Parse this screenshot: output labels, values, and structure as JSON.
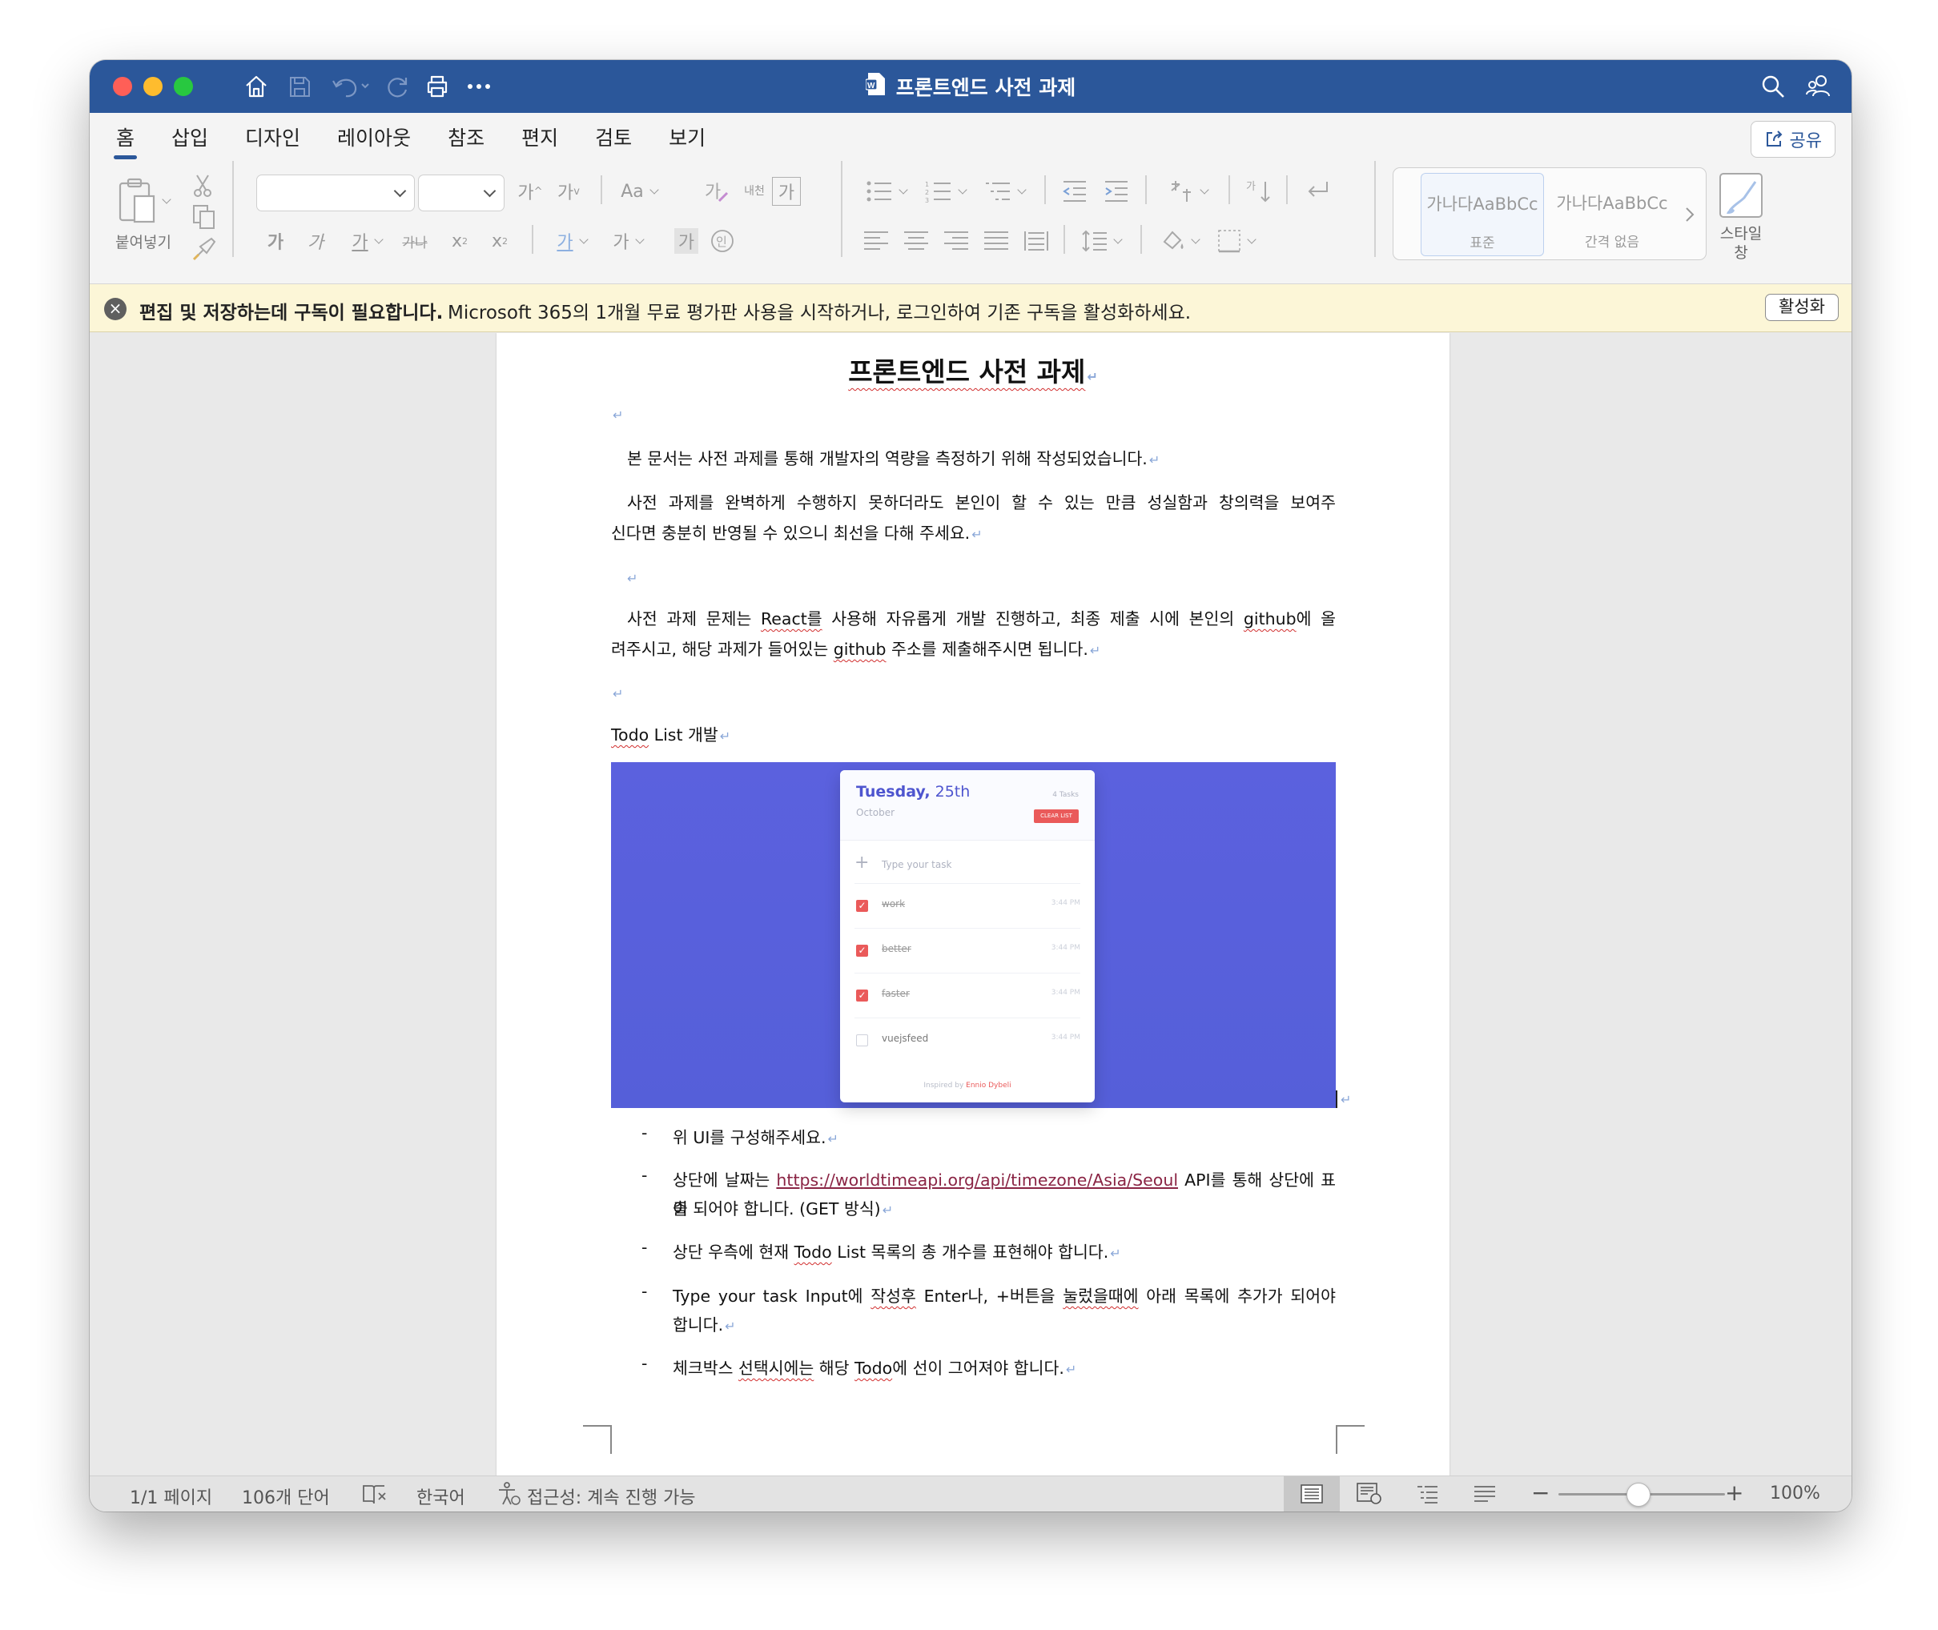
{
  "window": {
    "title": "프론트엔드 사전 과제",
    "colors": {
      "titlebar": "#2b579a",
      "close": "#ff5f57",
      "minimize": "#febc2e",
      "zoom": "#28c840"
    }
  },
  "ribbon": {
    "tabs": [
      "홈",
      "삽입",
      "디자인",
      "레이아웃",
      "참조",
      "편지",
      "검토",
      "보기"
    ],
    "active_tab": "홈",
    "share_label": "공유",
    "paste_label": "붙여넣기",
    "font_grow": "가",
    "font_shrink": "가",
    "change_case": "Aa",
    "phonetic_label": "내천",
    "bold": "가",
    "italic": "가",
    "underline": "가",
    "strike": "가나",
    "subscript": "x",
    "superscript": "x",
    "font_color": "가",
    "highlight": "가",
    "char_shade": "가",
    "enclose": "가",
    "styles": [
      {
        "preview": "가나다AaBbCc",
        "name": "표준"
      },
      {
        "preview": "가나다AaBbCc",
        "name": "간격 없음"
      }
    ],
    "styles_pane_label": "스타일\n창"
  },
  "notice": {
    "bold_text": "편집 및 저장하는데 구독이 필요합니다.",
    "message": "Microsoft 365의 1개월 무료 평가판 사용을 시작하거나, 로그인하여 기존 구독을 활성화하세요.",
    "button": "활성화"
  },
  "document": {
    "title": "프론트엔드 사전 과제",
    "p1": "본 문서는 사전 과제를 통해 개발자의 역량을 측정하기 위해 작성되었습니다.",
    "p2_line1": "사전 과제를 완벽하게 수행하지 못하더라도 본인이 할 수 있는 만큼 성실함과 창의력을 보여주",
    "p2_line2": "신다면 충분히 반영될 수 있으니 최선을 다해 주세요.",
    "p3_line1_a": "사전 과제 문제는 ",
    "p3_line1_react": "React를",
    "p3_line1_b": " 사용해 자유롭게 개발 진행하고, 최종 제출 시에 본인의 ",
    "p3_line1_github": "github",
    "p3_line1_c": "에 올",
    "p3_line2_a": "려주시고, 해당 과제가 들어있는 ",
    "p3_line2_github": "github",
    "p3_line2_b": " 주소를 제출해주시면 됩니다.",
    "section_todo": "Todo",
    "section_rest": " List 개발",
    "bullets": {
      "b1": "위 UI를 구성해주세요.",
      "b2_a": "상단에 날짜는 ",
      "b2_link": "https://worldtimeapi.org/api/timezone/Asia/Seoul",
      "b2_b": " API를 통해 상단에 표출",
      "b2_line2": "이 되어야 합니다. (GET 방식)",
      "b3_a": "상단 우측에 현재 ",
      "b3_todo": "Todo",
      "b3_b": " List 목록의 총 개수를 표현해야 합니다.",
      "b4_a": "Type your task Input에 ",
      "b4_sq1": "작성후",
      "b4_b": " Enter나, +버튼을 ",
      "b4_sq2": "눌렀을때에",
      "b4_c": " 아래 목록에 추가가 되어야",
      "b4_line2": "합니다.",
      "b5_a": "체크박스 ",
      "b5_sq": "선택시에는",
      "b5_b": " 해당 ",
      "b5_todo": "Todo",
      "b5_c": "에 선이 그어져야 합니다."
    }
  },
  "todo_app": {
    "day": "Tuesday,",
    "date": " 25th",
    "month": "October",
    "task_count": "4 Tasks",
    "clear_button": "CLEAR LIST",
    "placeholder": "Type your task",
    "items": [
      {
        "text": "work",
        "done": true,
        "time": "3:44 PM"
      },
      {
        "text": "better",
        "done": true,
        "time": "3:44 PM"
      },
      {
        "text": "faster",
        "done": true,
        "time": "3:44 PM"
      },
      {
        "text": "vuejsfeed",
        "done": false,
        "time": "3:44 PM"
      }
    ],
    "inspired_prefix": "Inspired by ",
    "inspired_name": "Ennio Dybeli",
    "colors": {
      "accent": "#4e55cf",
      "background": "#5a60dd",
      "check": "#ea5a5a"
    }
  },
  "statusbar": {
    "page": "1/1 페이지",
    "words": "106개 단어",
    "language": "한국어",
    "accessibility": "접근성: 계속 진행 가능",
    "zoom": "100%",
    "zoom_level": 0.5
  }
}
